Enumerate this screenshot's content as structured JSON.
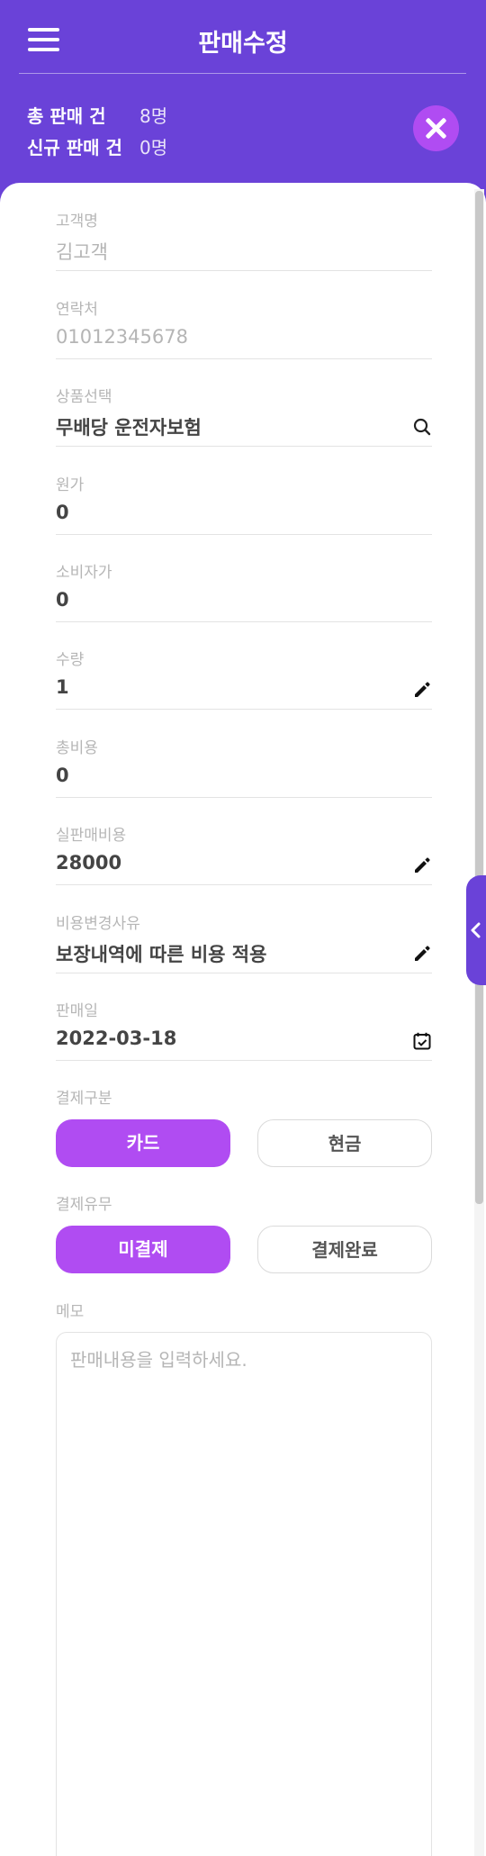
{
  "header": {
    "title": "판매수정",
    "summary": [
      {
        "label": "총 판매 건",
        "value": "8명"
      },
      {
        "label": "신규 판매 건",
        "value": "0명"
      }
    ]
  },
  "icons": {
    "menu": "hamburger-menu-icon",
    "close": "close-icon",
    "search": "search-icon",
    "edit": "pencil-icon",
    "calendar": "calendar-check-icon",
    "side_toggle": "chevron-left-icon"
  },
  "colors": {
    "primary": "#6a42d8",
    "accent": "#b04cf2",
    "label": "#b6b6b6"
  },
  "fields": {
    "customer_name": {
      "label": "고객명",
      "value": "김고객"
    },
    "contact": {
      "label": "연락처",
      "value": "01012345678"
    },
    "product": {
      "label": "상품선택",
      "value": "무배당 운전자보험"
    },
    "cost_price": {
      "label": "원가",
      "value": "0"
    },
    "consumer_price": {
      "label": "소비자가",
      "value": "0"
    },
    "quantity": {
      "label": "수량",
      "value": "1"
    },
    "total_cost": {
      "label": "총비용",
      "value": "0"
    },
    "actual_sale_price": {
      "label": "실판매비용",
      "value": "28000"
    },
    "price_change_reason": {
      "label": "비용변경사유",
      "value": "보장내역에 따른 비용 적용"
    },
    "sale_date": {
      "label": "판매일",
      "value": "2022-03-18"
    }
  },
  "payment_type": {
    "label": "결제구분",
    "options": [
      "카드",
      "현금"
    ],
    "selected": "카드"
  },
  "payment_status": {
    "label": "결제유무",
    "options": [
      "미결제",
      "결제완료"
    ],
    "selected": "미결제"
  },
  "memo": {
    "label": "메모",
    "placeholder": "판매내용을 입력하세요.",
    "value": ""
  }
}
